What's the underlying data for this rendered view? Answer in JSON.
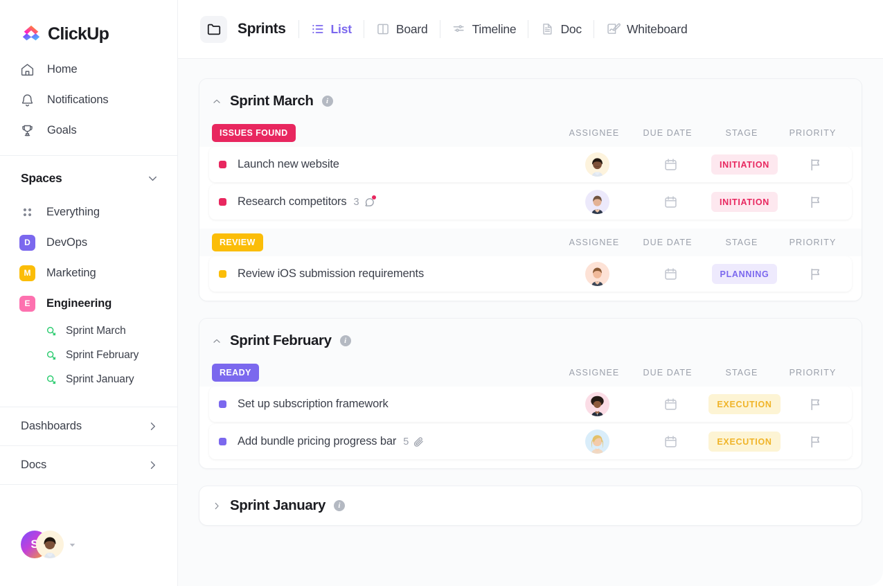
{
  "brand": {
    "name": "ClickUp"
  },
  "sidebar": {
    "nav": [
      {
        "label": "Home",
        "icon": "home-icon"
      },
      {
        "label": "Notifications",
        "icon": "bell-icon"
      },
      {
        "label": "Goals",
        "icon": "trophy-icon"
      }
    ],
    "spaces_title": "Spaces",
    "spaces": [
      {
        "label": "Everything",
        "badge": "",
        "badge_color": "",
        "icon": "grid-dots-icon",
        "active": false
      },
      {
        "label": "DevOps",
        "badge": "D",
        "badge_color": "#7b68ee",
        "active": false
      },
      {
        "label": "Marketing",
        "badge": "M",
        "badge_color": "#fbbd08",
        "active": false
      },
      {
        "label": "Engineering",
        "badge": "E",
        "badge_color": "#fd71af",
        "active": true
      }
    ],
    "sprints": [
      {
        "label": "Sprint  March"
      },
      {
        "label": "Sprint  February"
      },
      {
        "label": "Sprint January"
      }
    ],
    "sections": [
      {
        "label": "Dashboards"
      },
      {
        "label": "Docs"
      }
    ],
    "footer": {
      "avatar_initial": "S"
    }
  },
  "toolbar": {
    "folder_title": "Sprints",
    "folder_icon": "folder-icon",
    "tabs": [
      {
        "label": "List",
        "icon": "list-icon",
        "active": true
      },
      {
        "label": "Board",
        "icon": "board-icon",
        "active": false
      },
      {
        "label": "Timeline",
        "icon": "timeline-icon",
        "active": false
      },
      {
        "label": "Doc",
        "icon": "doc-icon",
        "active": false
      },
      {
        "label": "Whiteboard",
        "icon": "whiteboard-icon",
        "active": false
      }
    ]
  },
  "columns": {
    "assignee": "ASSIGNEE",
    "due_date": "DUE DATE",
    "stage": "STAGE",
    "priority": "PRIORITY"
  },
  "colors": {
    "accent": "#7b68ee",
    "issues_found": "#e8275f",
    "review": "#fbbd08",
    "ready": "#7b68ee",
    "initiation_bg": "#fde8ef",
    "initiation_text": "#e8275f",
    "planning_bg": "#eeeafd",
    "planning_text": "#7b68ee",
    "execution_bg": "#fdf4d4",
    "execution_text": "#f0b429"
  },
  "groups": [
    {
      "title": "Sprint March",
      "collapsed": false,
      "statuses": [
        {
          "label": "ISSUES FOUND",
          "color": "#e8275f",
          "tasks": [
            {
              "name": "Launch new website",
              "dot_color": "#e8275f",
              "comment_count": "",
              "attachment_count": "",
              "assignee_bg": "#fdf3dd",
              "assignee_skin": "#7d5139",
              "assignee_hair": "#20160f",
              "assignee_shirt": "#dfe6ef",
              "stage": "INITIATION",
              "stage_bg": "#fde8ef",
              "stage_color": "#e8275f"
            },
            {
              "name": "Research competitors",
              "dot_color": "#e8275f",
              "comment_count": "3",
              "attachment_count": "",
              "assignee_bg": "#ece9fb",
              "assignee_skin": "#e3b295",
              "assignee_hair": "#6f5340",
              "assignee_shirt": "#2f3a4d",
              "stage": "INITIATION",
              "stage_bg": "#fde8ef",
              "stage_color": "#e8275f"
            }
          ]
        },
        {
          "label": "REVIEW",
          "color": "#fbbd08",
          "tasks": [
            {
              "name": "Review iOS submission requirements",
              "dot_color": "#fbbd08",
              "comment_count": "",
              "attachment_count": "",
              "assignee_bg": "#fde2d6",
              "assignee_skin": "#f0b99a",
              "assignee_hair": "#8a5a35",
              "assignee_shirt": "#3c4757",
              "stage": "PLANNING",
              "stage_bg": "#eeeafd",
              "stage_color": "#7b68ee"
            }
          ]
        }
      ]
    },
    {
      "title": "Sprint February",
      "collapsed": false,
      "statuses": [
        {
          "label": "READY",
          "color": "#7b68ee",
          "tasks": [
            {
              "name": "Set up subscription framework",
              "dot_color": "#7b68ee",
              "comment_count": "",
              "attachment_count": "",
              "assignee_bg": "#fbdde6",
              "assignee_skin": "#8d5a3c",
              "assignee_hair": "#231a14",
              "assignee_shirt": "#27303e",
              "stage": "EXECUTION",
              "stage_bg": "#fdf4d4",
              "stage_color": "#f0b429"
            },
            {
              "name": "Add bundle pricing progress bar",
              "dot_color": "#7b68ee",
              "comment_count": "",
              "attachment_count": "5",
              "assignee_bg": "#d9edfa",
              "assignee_skin": "#f3cbab",
              "assignee_hair": "#e3c06a",
              "assignee_shirt": "#f0d9c4",
              "stage": "EXECUTION",
              "stage_bg": "#fdf4d4",
              "stage_color": "#f0b429"
            }
          ]
        }
      ]
    },
    {
      "title": "Sprint January",
      "collapsed": true,
      "statuses": []
    }
  ]
}
